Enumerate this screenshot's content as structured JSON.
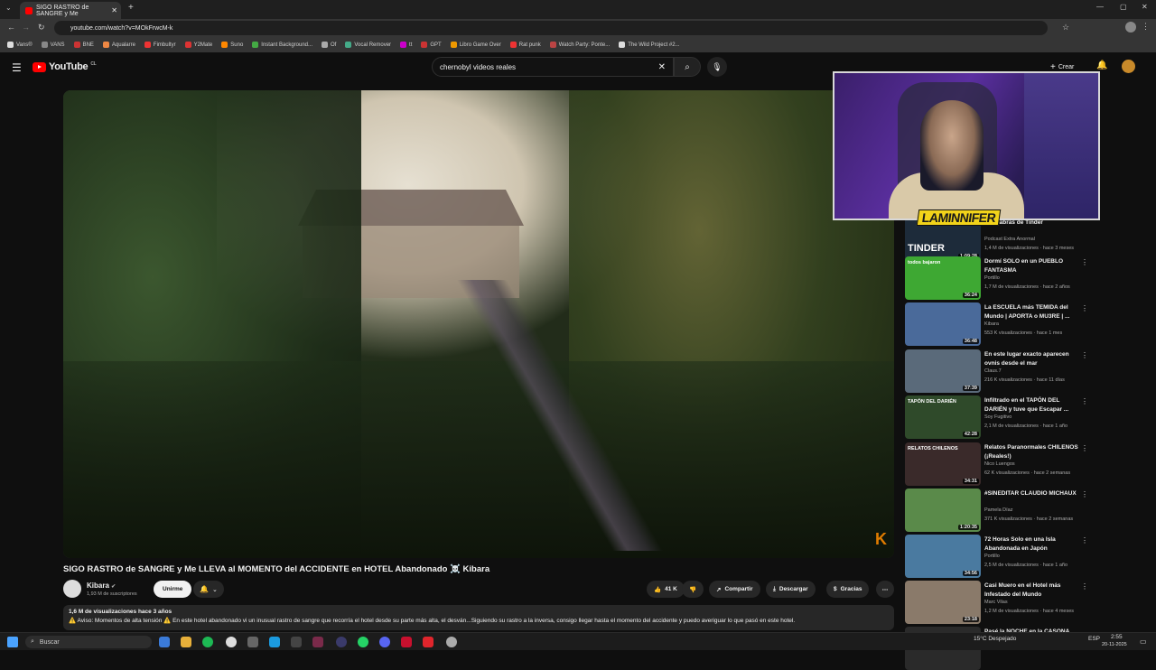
{
  "browser": {
    "tab_title": "SIGO RASTRO de SANGRE y Me",
    "url": "youtube.com/watch?v=MOkFrwcM-k",
    "bookmarks": [
      "Vans®",
      "VANS",
      "BNE",
      "Aqualarre",
      "Fimbultyr",
      "Y2Mate",
      "Suno",
      "Instant Background...",
      "Of",
      "Vocal Remover",
      "tt",
      "GPT",
      "Libro Game Over",
      "Rat punk",
      "Watch Party: Ponte...",
      "The Wild Project #2..."
    ]
  },
  "header": {
    "logo": "YouTube",
    "logo_region": "CL",
    "search_value": "chernobyl videos reales",
    "create_label": "Crear"
  },
  "overlay": {
    "streamer_name": "LAMINNIFER"
  },
  "video": {
    "title": "SIGO RASTRO de SANGRE y Me LLEVA al MOMENTO del ACCIDENTE en HOTEL Abandonado ☠️ Kibara",
    "channel": "Kibara",
    "subscribers": "1,93 M de suscriptores",
    "join_label": "Unirme",
    "likes": "41 K",
    "share_label": "Compartir",
    "download_label": "Descargar",
    "thanks_label": "Gracias",
    "views_date": "1,6 M de visualizaciones  hace 3 años",
    "description": "⚠️ Aviso: Momentos de alta tensión ⚠️  En este hotel abandonado vi un inusual rastro de sangre que recorría el hotel desde su parte más alta, el desván...Siguiendo su rastro a la inversa, consigo llegar hasta el momento del accidente y puedo averiguar lo que pasó en este hotel."
  },
  "recommendations": [
    {
      "title": "...nacabras de Tinder",
      "channel": "Podcast Extra Anormal",
      "meta": "1,4 M de visualizaciones · hace 3 meses",
      "duration": "1:09:28",
      "color": "#1d2b3a",
      "thumb_text": "TINDER"
    },
    {
      "title": "Dormí SOLO en un PUEBLO FANTASMA",
      "channel": "Portillo",
      "meta": "1,7 M de visualizaciones · hace 2 años",
      "duration": "36:24",
      "color": "#3ea833",
      "thumb_text": "todos bajaron"
    },
    {
      "title": "La ESCUELA más TEMIDA del Mundo | APORTA o MU3RE | ...",
      "channel": "Kibara",
      "meta": "553 K visualizaciones · hace 1 mes",
      "duration": "36:48",
      "color": "#4a6a9a",
      "thumb_text": ""
    },
    {
      "title": "En este lugar exacto aparecen ovnis desde el mar",
      "channel": "Claus.7",
      "meta": "216 K visualizaciones · hace 11 días",
      "duration": "37:39",
      "color": "#5a6a7a",
      "thumb_text": ""
    },
    {
      "title": "Infiltrado en el TAPÓN DEL DARIÉN y tuve que Escapar ...",
      "channel": "Soy Fugitivo",
      "meta": "2,1 M de visualizaciones · hace 1 año",
      "duration": "42:28",
      "color": "#2f4a2a",
      "thumb_text": "TAPÓN DEL DARIÉN"
    },
    {
      "title": "Relatos Paranormales CHILENOS (¡Reales!)",
      "channel": "Nico Luengos",
      "meta": "62 K visualizaciones · hace 2 semanas",
      "duration": "34:31",
      "color": "#3a2a2a",
      "thumb_text": "RELATOS CHILENOS"
    },
    {
      "title": "#SINEDITAR CLAUDIO MICHAUX",
      "channel": "Pamela Díaz",
      "meta": "371 K visualizaciones · hace 2 semanas",
      "duration": "1:20:35",
      "color": "#5a8a4a",
      "thumb_text": ""
    },
    {
      "title": "72 Horas Solo en una Isla Abandonada en Japón",
      "channel": "Portillo",
      "meta": "2,5 M de visualizaciones · hace 1 año",
      "duration": "34:56",
      "color": "#4a7aa0",
      "thumb_text": ""
    },
    {
      "title": "Casi Muero en el Hotel más Infestado del Mundo",
      "channel": "Marc Vilas",
      "meta": "1,2 M de visualizaciones · hace 4 meses",
      "duration": "23:18",
      "color": "#8a7a6a",
      "thumb_text": ""
    },
    {
      "title": "Pasé la NOCHE en la CASONA",
      "channel": "",
      "meta": "",
      "duration": "",
      "color": "#2a2a2a",
      "thumb_text": ""
    }
  ],
  "taskbar": {
    "search_placeholder": "Buscar",
    "weather": "15°C  Despejado",
    "lang": "ESP",
    "time": "2:55",
    "date": "20-11-2025"
  }
}
